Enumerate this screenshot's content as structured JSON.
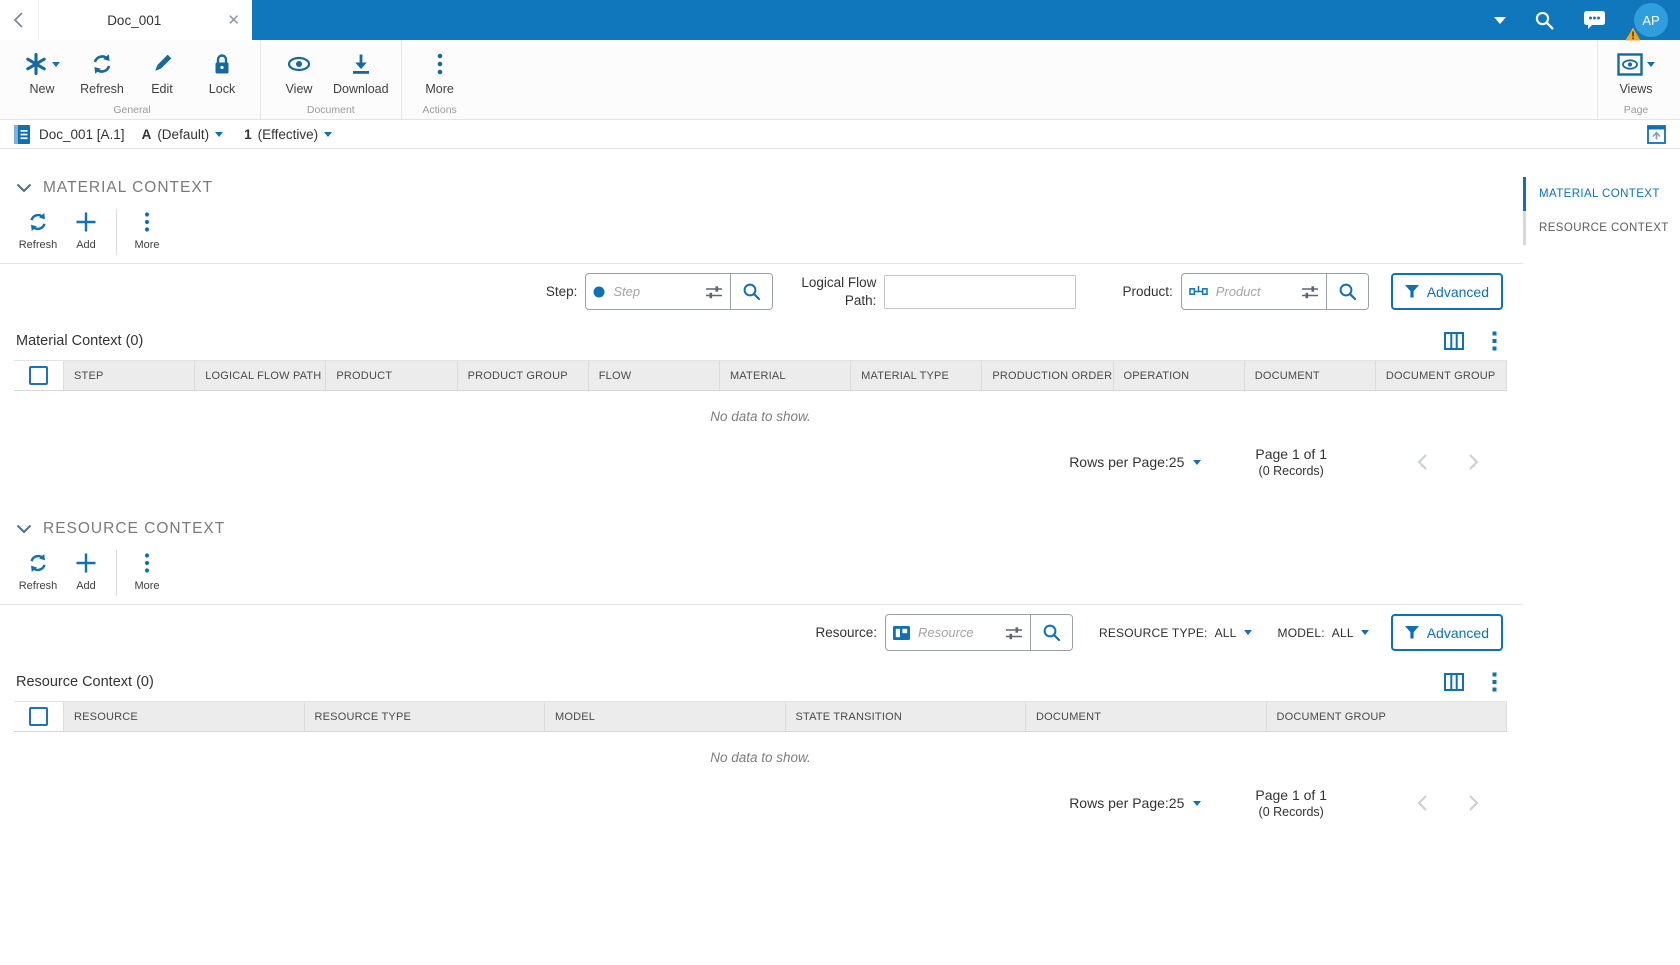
{
  "colors": {
    "topbar_bg": "#1177bd",
    "accent": "#15699f",
    "accent_bright": "#0f70b6",
    "avatar_bg": "#2e9fdc",
    "warning": "#f2a71e",
    "table_header_bg": "#ececec"
  },
  "topbar": {
    "tab_title": "Doc_001",
    "avatar_initials": "AP"
  },
  "ribbon": {
    "groups": [
      {
        "label": "General",
        "buttons": [
          {
            "label": "New"
          },
          {
            "label": "Refresh"
          },
          {
            "label": "Edit"
          },
          {
            "label": "Lock"
          }
        ]
      },
      {
        "label": "Document",
        "buttons": [
          {
            "label": "View"
          },
          {
            "label": "Download"
          }
        ]
      },
      {
        "label": "Actions",
        "buttons": [
          {
            "label": "More"
          }
        ]
      },
      {
        "label": "Page",
        "buttons": [
          {
            "label": "Views"
          }
        ]
      }
    ]
  },
  "breadcrumb": {
    "doc_title": "Doc_001 [A.1]",
    "revision": "A",
    "revision_label": "(Default)",
    "version": "1",
    "version_label": "(Effective)"
  },
  "right_nav": {
    "items": [
      {
        "label": "MATERIAL CONTEXT"
      },
      {
        "label": "RESOURCE CONTEXT"
      }
    ]
  },
  "material_section": {
    "title": "MATERIAL CONTEXT",
    "toolbar": {
      "refresh": "Refresh",
      "add": "Add",
      "more": "More"
    },
    "filters": {
      "step_label": "Step:",
      "step_placeholder": "Step",
      "lfp_label_line1": "Logical Flow",
      "lfp_label_line2": "Path:",
      "product_label": "Product:",
      "product_placeholder": "Product",
      "advanced_label": "Advanced"
    },
    "table": {
      "title": "Material Context (0)",
      "columns": [
        "STEP",
        "LOGICAL FLOW PATH",
        "PRODUCT",
        "PRODUCT GROUP",
        "FLOW",
        "MATERIAL",
        "MATERIAL TYPE",
        "PRODUCTION ORDER",
        "OPERATION",
        "DOCUMENT",
        "DOCUMENT GROUP"
      ],
      "empty_text": "No data to show.",
      "pagination": {
        "rows_per_page": "Rows per Page:25",
        "page": "Page 1 of 1",
        "records": "(0 Records)"
      }
    }
  },
  "resource_section": {
    "title": "RESOURCE CONTEXT",
    "toolbar": {
      "refresh": "Refresh",
      "add": "Add",
      "more": "More"
    },
    "filters": {
      "resource_label": "Resource:",
      "resource_placeholder": "Resource",
      "type_label": "RESOURCE TYPE:",
      "type_value": "ALL",
      "model_label": "MODEL:",
      "model_value": "ALL",
      "advanced_label": "Advanced"
    },
    "table": {
      "title": "Resource Context (0)",
      "columns": [
        "RESOURCE",
        "RESOURCE TYPE",
        "MODEL",
        "STATE TRANSITION",
        "DOCUMENT",
        "DOCUMENT GROUP"
      ],
      "empty_text": "No data to show.",
      "pagination": {
        "rows_per_page": "Rows per Page:25",
        "page": "Page 1 of 1",
        "records": "(0 Records)"
      }
    }
  }
}
